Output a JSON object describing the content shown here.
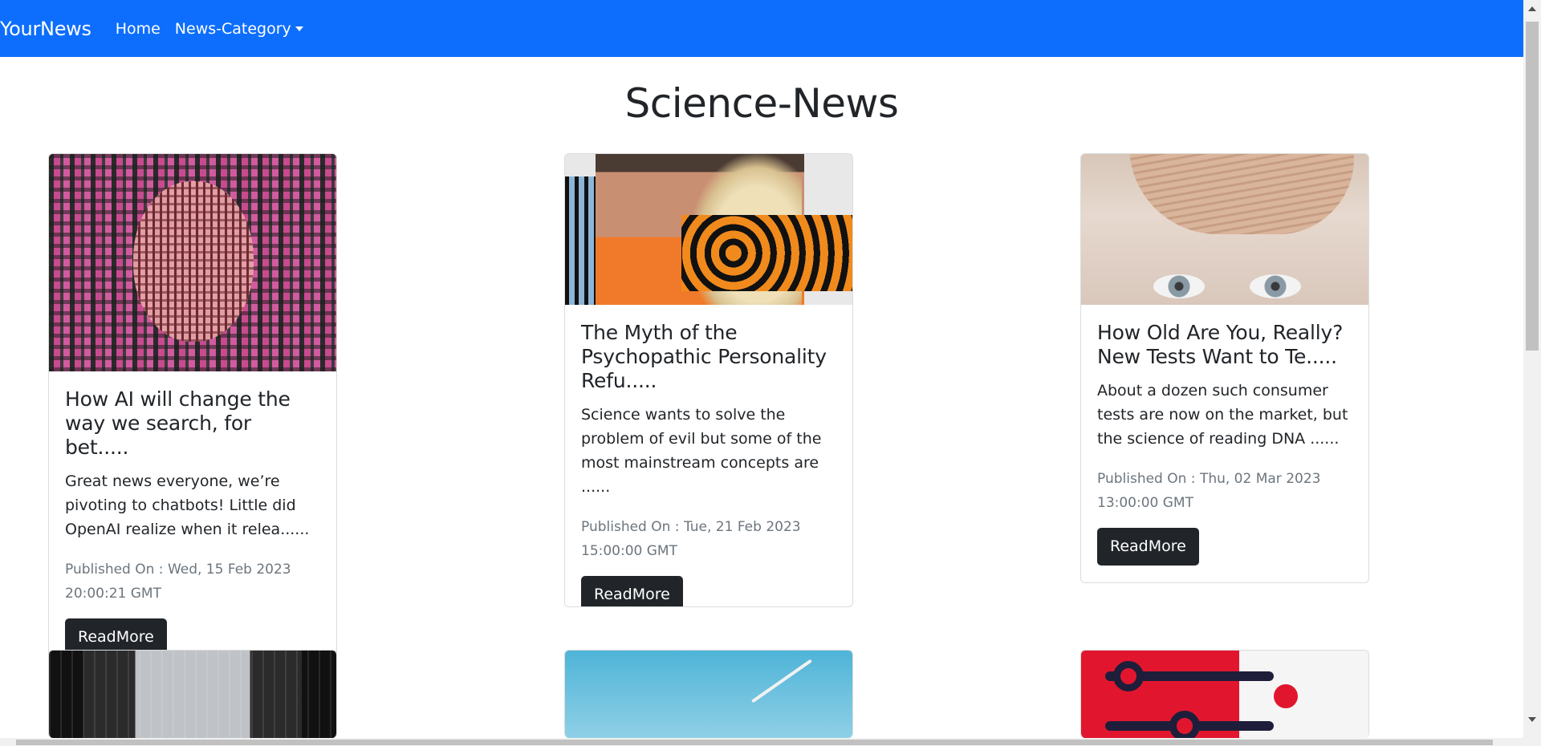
{
  "navbar": {
    "brand": "YourNews",
    "links": [
      {
        "label": "Home"
      },
      {
        "label": "News-Category"
      }
    ],
    "background": "#0d6efd"
  },
  "page_title": "Science-News",
  "cards": [
    {
      "title": "How AI will change the way we search, for bet.....",
      "text": "Great news everyone, we’re pivoting to chatbots! Little did OpenAI realize when it relea......",
      "published": "Published On : Wed, 15 Feb 2023 20:00:21 GMT",
      "button": "ReadMore",
      "image": "maze-brain-image"
    },
    {
      "title": "The Myth of the Psychopathic Personality Refu.....",
      "text": "Science wants to solve the problem of evil but some of the most mainstream concepts are ......",
      "published": "Published On : Tue, 21 Feb 2023 15:00:00 GMT",
      "button": "ReadMore",
      "image": "psychopath-collage-image"
    },
    {
      "title": "How Old Are You, Really? New Tests Want to Te.....",
      "text": "About a dozen such consumer tests are now on the market, but the science of reading DNA ......",
      "published": "Published On : Thu, 02 Mar 2023 13:00:00 GMT",
      "button": "ReadMore",
      "image": "child-forehead-image"
    }
  ],
  "button_color": "#212529"
}
